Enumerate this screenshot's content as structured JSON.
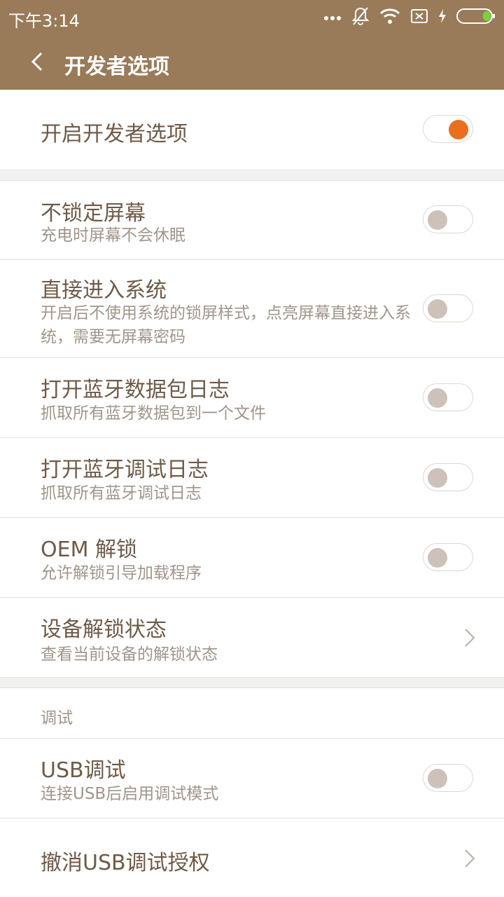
{
  "status_bar": {
    "time": "下午3:14",
    "icons": [
      "more-dots-icon",
      "bell-off-icon",
      "wifi-icon",
      "sim-x-icon",
      "charging-bolt-icon",
      "battery-icon"
    ]
  },
  "header": {
    "title": "开发者选项",
    "background_color": "#9a7b59"
  },
  "master_toggle": {
    "label": "开启开发者选项",
    "on": true,
    "accent_color": "#e96f1f"
  },
  "settings": [
    {
      "title": "不锁定屏幕",
      "subtitle": "充电时屏幕不会休眠",
      "control": "toggle",
      "on": false
    },
    {
      "title": "直接进入系统",
      "subtitle": "开启后不使用系统的锁屏样式，点亮屏幕直接进入系统，需要无屏幕密码",
      "control": "toggle",
      "on": false
    },
    {
      "title": "打开蓝牙数据包日志",
      "subtitle": "抓取所有蓝牙数据包到一个文件",
      "control": "toggle",
      "on": false
    },
    {
      "title": "打开蓝牙调试日志",
      "subtitle": "抓取所有蓝牙调试日志",
      "control": "toggle",
      "on": false
    },
    {
      "title": "OEM 解锁",
      "subtitle": "允许解锁引导加载程序",
      "control": "toggle",
      "on": false
    },
    {
      "title": "设备解锁状态",
      "subtitle": "查看当前设备的解锁状态",
      "control": "chevron"
    }
  ],
  "debug_section": {
    "label": "调试",
    "items": [
      {
        "title": "USB调试",
        "subtitle": "连接USB后启用调试模式",
        "control": "toggle",
        "on": false
      },
      {
        "title": "撤消USB调试授权",
        "control": "chevron"
      }
    ]
  }
}
